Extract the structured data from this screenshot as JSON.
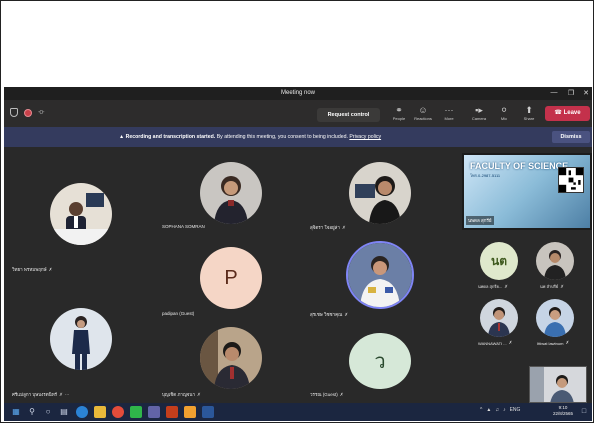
{
  "window": {
    "title": "Meeting now"
  },
  "toolbar": {
    "request_control_label": "Request control",
    "items": [
      {
        "label": "People",
        "icon": "people-icon"
      },
      {
        "label": "Reactions",
        "icon": "reactions-icon"
      },
      {
        "label": "More",
        "icon": "more-icon"
      },
      {
        "label": "Camera",
        "icon": "camera-icon"
      },
      {
        "label": "Mic",
        "icon": "mic-off-icon"
      },
      {
        "label": "Share",
        "icon": "share-icon"
      }
    ],
    "leave_label": "Leave"
  },
  "banner": {
    "bold_text": "Recording and transcription started.",
    "text": "By attending this meeting, you consent to being included.",
    "link_text": "Privacy policy",
    "dismiss_label": "Dismiss"
  },
  "participants": [
    {
      "name": "วิทยา พรหมพฤกษ์",
      "type": "photo"
    },
    {
      "name": "SOPHANA SOMRAN",
      "type": "photo"
    },
    {
      "name": "สุจิตรา ใจอยู่ล่า",
      "type": "photo"
    },
    {
      "name": "padipan (Guest)",
      "type": "letter",
      "letter": "P",
      "color": "#f5d6c6",
      "letter_color": "#5a2a1a"
    },
    {
      "name": "สุรเชษ วิชชาคุณ",
      "type": "photo"
    },
    {
      "name": "ศรีแม่ลูกา บุษบงรตนิทร์",
      "type": "photo"
    },
    {
      "name": "บุญเชิด ภาญจนา",
      "type": "photo"
    },
    {
      "name": "วรรณ (Guest)",
      "type": "letter",
      "letter": "ว",
      "color": "#d6e8d8",
      "letter_color": "#2a4a2e"
    }
  ],
  "side_participants": [
    {
      "name": "นพดล สุกรีย...",
      "type": "letter",
      "letter": "นต",
      "color": "#dfe8cc",
      "letter_color": "#3f5a1f"
    },
    {
      "name": "นพ ลำปรีย์",
      "type": "photo"
    },
    {
      "name": "WANNAWATI ...",
      "type": "photo"
    },
    {
      "name": "Ittiwat lawtnum",
      "type": "photo"
    }
  ],
  "shared_content": {
    "title": "FACULTY OF SCIENCE",
    "subtitle": "โทร.0-2987-5111",
    "caption": "นพดล สุกรีย์"
  },
  "taskbar": {
    "time": "9:10",
    "date": "22/8/2565",
    "lang": "ENG"
  }
}
